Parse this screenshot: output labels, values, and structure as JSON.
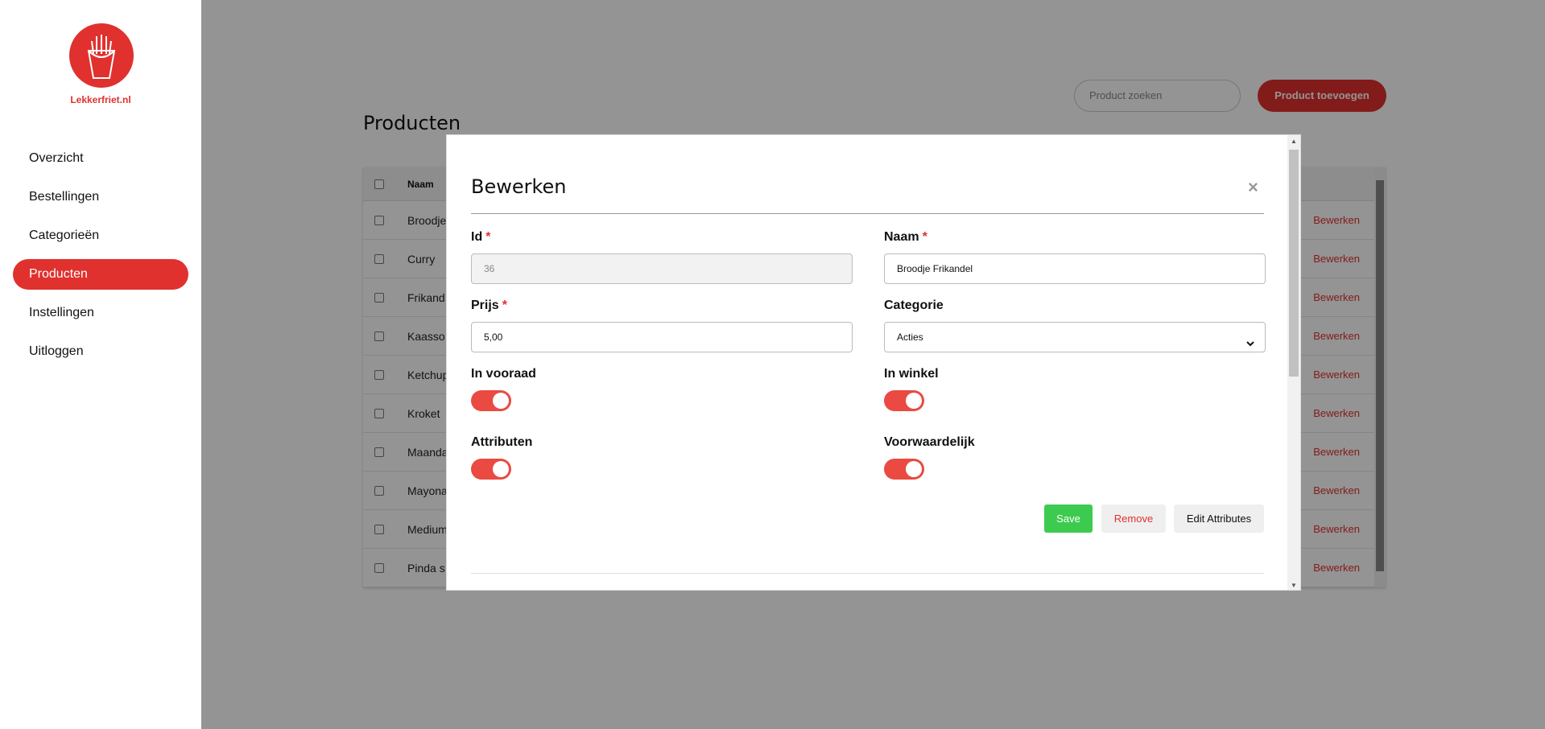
{
  "brand": {
    "name": "Lekkerfriet.nl",
    "accent": "#e0312e"
  },
  "sidebar": {
    "items": [
      {
        "label": "Overzicht"
      },
      {
        "label": "Bestellingen"
      },
      {
        "label": "Categorieën"
      },
      {
        "label": "Producten",
        "active": true
      },
      {
        "label": "Instellingen"
      },
      {
        "label": "Uitloggen"
      }
    ]
  },
  "page": {
    "title": "Producten",
    "search_placeholder": "Product zoeken",
    "add_button": "Product toevoegen"
  },
  "table": {
    "header_name": "Naam",
    "edit_label": "Bewerken",
    "rows": [
      {
        "name": "Broodje"
      },
      {
        "name": "Curry"
      },
      {
        "name": "Frikand"
      },
      {
        "name": "Kaasso"
      },
      {
        "name": "Ketchup"
      },
      {
        "name": "Kroket"
      },
      {
        "name": "Maanda"
      },
      {
        "name": "Mayona"
      },
      {
        "name": "Medium"
      },
      {
        "name": "Pinda s"
      }
    ]
  },
  "modal": {
    "title": "Bewerken",
    "close": "×",
    "id": {
      "label": "Id",
      "value": "36"
    },
    "naam": {
      "label": "Naam",
      "value": "Broodje Frikandel"
    },
    "prijs": {
      "label": "Prijs",
      "value": "5,00"
    },
    "categorie": {
      "label": "Categorie",
      "value": "Acties"
    },
    "in_vooraad": {
      "label": "In vooraad",
      "on": true
    },
    "in_winkel": {
      "label": "In winkel",
      "on": true
    },
    "attributen": {
      "label": "Attributen",
      "on": true
    },
    "voorwaardelijk": {
      "label": "Voorwaardelijk",
      "on": true
    },
    "required_mark": "*",
    "save": "Save",
    "remove": "Remove",
    "edit_attributes": "Edit Attributes"
  },
  "colors": {
    "toggle_on": "#ea4a41",
    "save": "#3dcb4f"
  }
}
